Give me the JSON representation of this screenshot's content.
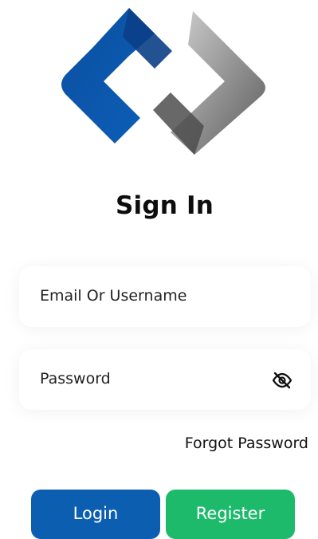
{
  "app": {
    "logo_icon": "interlinked-chain-logo",
    "colors": {
      "primary_blue": "#0c5fb0",
      "accent_green": "#1dba6c",
      "logo_gray": "#6f6f6f"
    }
  },
  "page": {
    "title": "Sign In"
  },
  "form": {
    "email_placeholder": "Email Or Username",
    "password_placeholder": "Password",
    "password_toggle_icon": "eye-off-icon",
    "forgot_label": "Forgot Password"
  },
  "actions": {
    "login_label": "Login",
    "register_label": "Register"
  }
}
